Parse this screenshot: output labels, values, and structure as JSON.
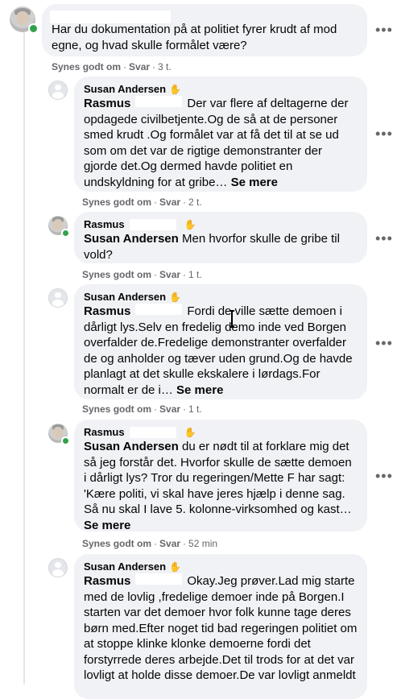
{
  "comments": [
    {
      "author": "",
      "text": "Har du dokumentation på at politiet fyrer krudt af mod egne, og hvad skulle formålet være?",
      "like_label": "Synes godt om",
      "reply_label": "Svar",
      "time": "3 t."
    },
    {
      "author": "Susan Andersen",
      "tag": "Rasmus",
      "text": "Der var flere af deltagerne der opdagede civilbetjente.Og de så at de personer smed krudt .Og formålet var at få det til at se ud som om det var de rigtige demonstranter der gjorde det.Og dermed havde politiet en undskyldning for at gribe…",
      "see_more": "Se mere",
      "like_label": "Synes godt om",
      "reply_label": "Svar",
      "time": "2 t."
    },
    {
      "author": "Rasmus",
      "tag": "Susan Andersen",
      "text": "Men hvorfor skulle de gribe til vold?",
      "like_label": "Synes godt om",
      "reply_label": "Svar",
      "time": "1 t."
    },
    {
      "author": "Susan Andersen",
      "tag": "Rasmus",
      "text": "Fordi de ville sætte demoen i dårligt lys.Selv en fredelig demo inde ved Borgen overfalder de.Fredelige demonstranter overfalder de og anholder og tæver uden grund.Og de havde planlagt at det skulle ekskalere i lørdags.For normalt er de i…",
      "see_more": "Se mere",
      "like_label": "Synes godt om",
      "reply_label": "Svar",
      "time": "1 t."
    },
    {
      "author": "Rasmus",
      "tag": "Susan Andersen",
      "text": "du er nødt til at forklare mig det så jeg forstår det. Hvorfor skulle de sætte demoen i dårligt lys? Tror du regeringen/Mette F har sagt: 'Kære politi, vi skal have jeres hjælp i denne sag. Så nu skal I lave 5. kolonne-virksomhed og kast…",
      "see_more": "Se mere",
      "like_label": "Synes godt om",
      "reply_label": "Svar",
      "time": "52 min"
    },
    {
      "author": "Susan Andersen",
      "tag": "Rasmus",
      "text": "Okay.Jeg prøver.Lad mig starte med de lovlig ,fredelige demoer inde på Borgen.I starten var det demoer hvor folk kunne tage deres børn med.Efter noget tid bad regeringen politiet om at stoppe klinke klonke demoerne fordi det forstyrrede deres arbejde.Det til trods for at det var lovligt at holde disse demoer.De var lovligt anmeldt"
    }
  ],
  "icons": {
    "more": "more-options-icon",
    "wave": "wave-hand-icon",
    "online": "online-status-icon"
  },
  "colors": {
    "bubble": "#f0f2f5",
    "meta": "#65676b",
    "online": "#31a24c"
  }
}
